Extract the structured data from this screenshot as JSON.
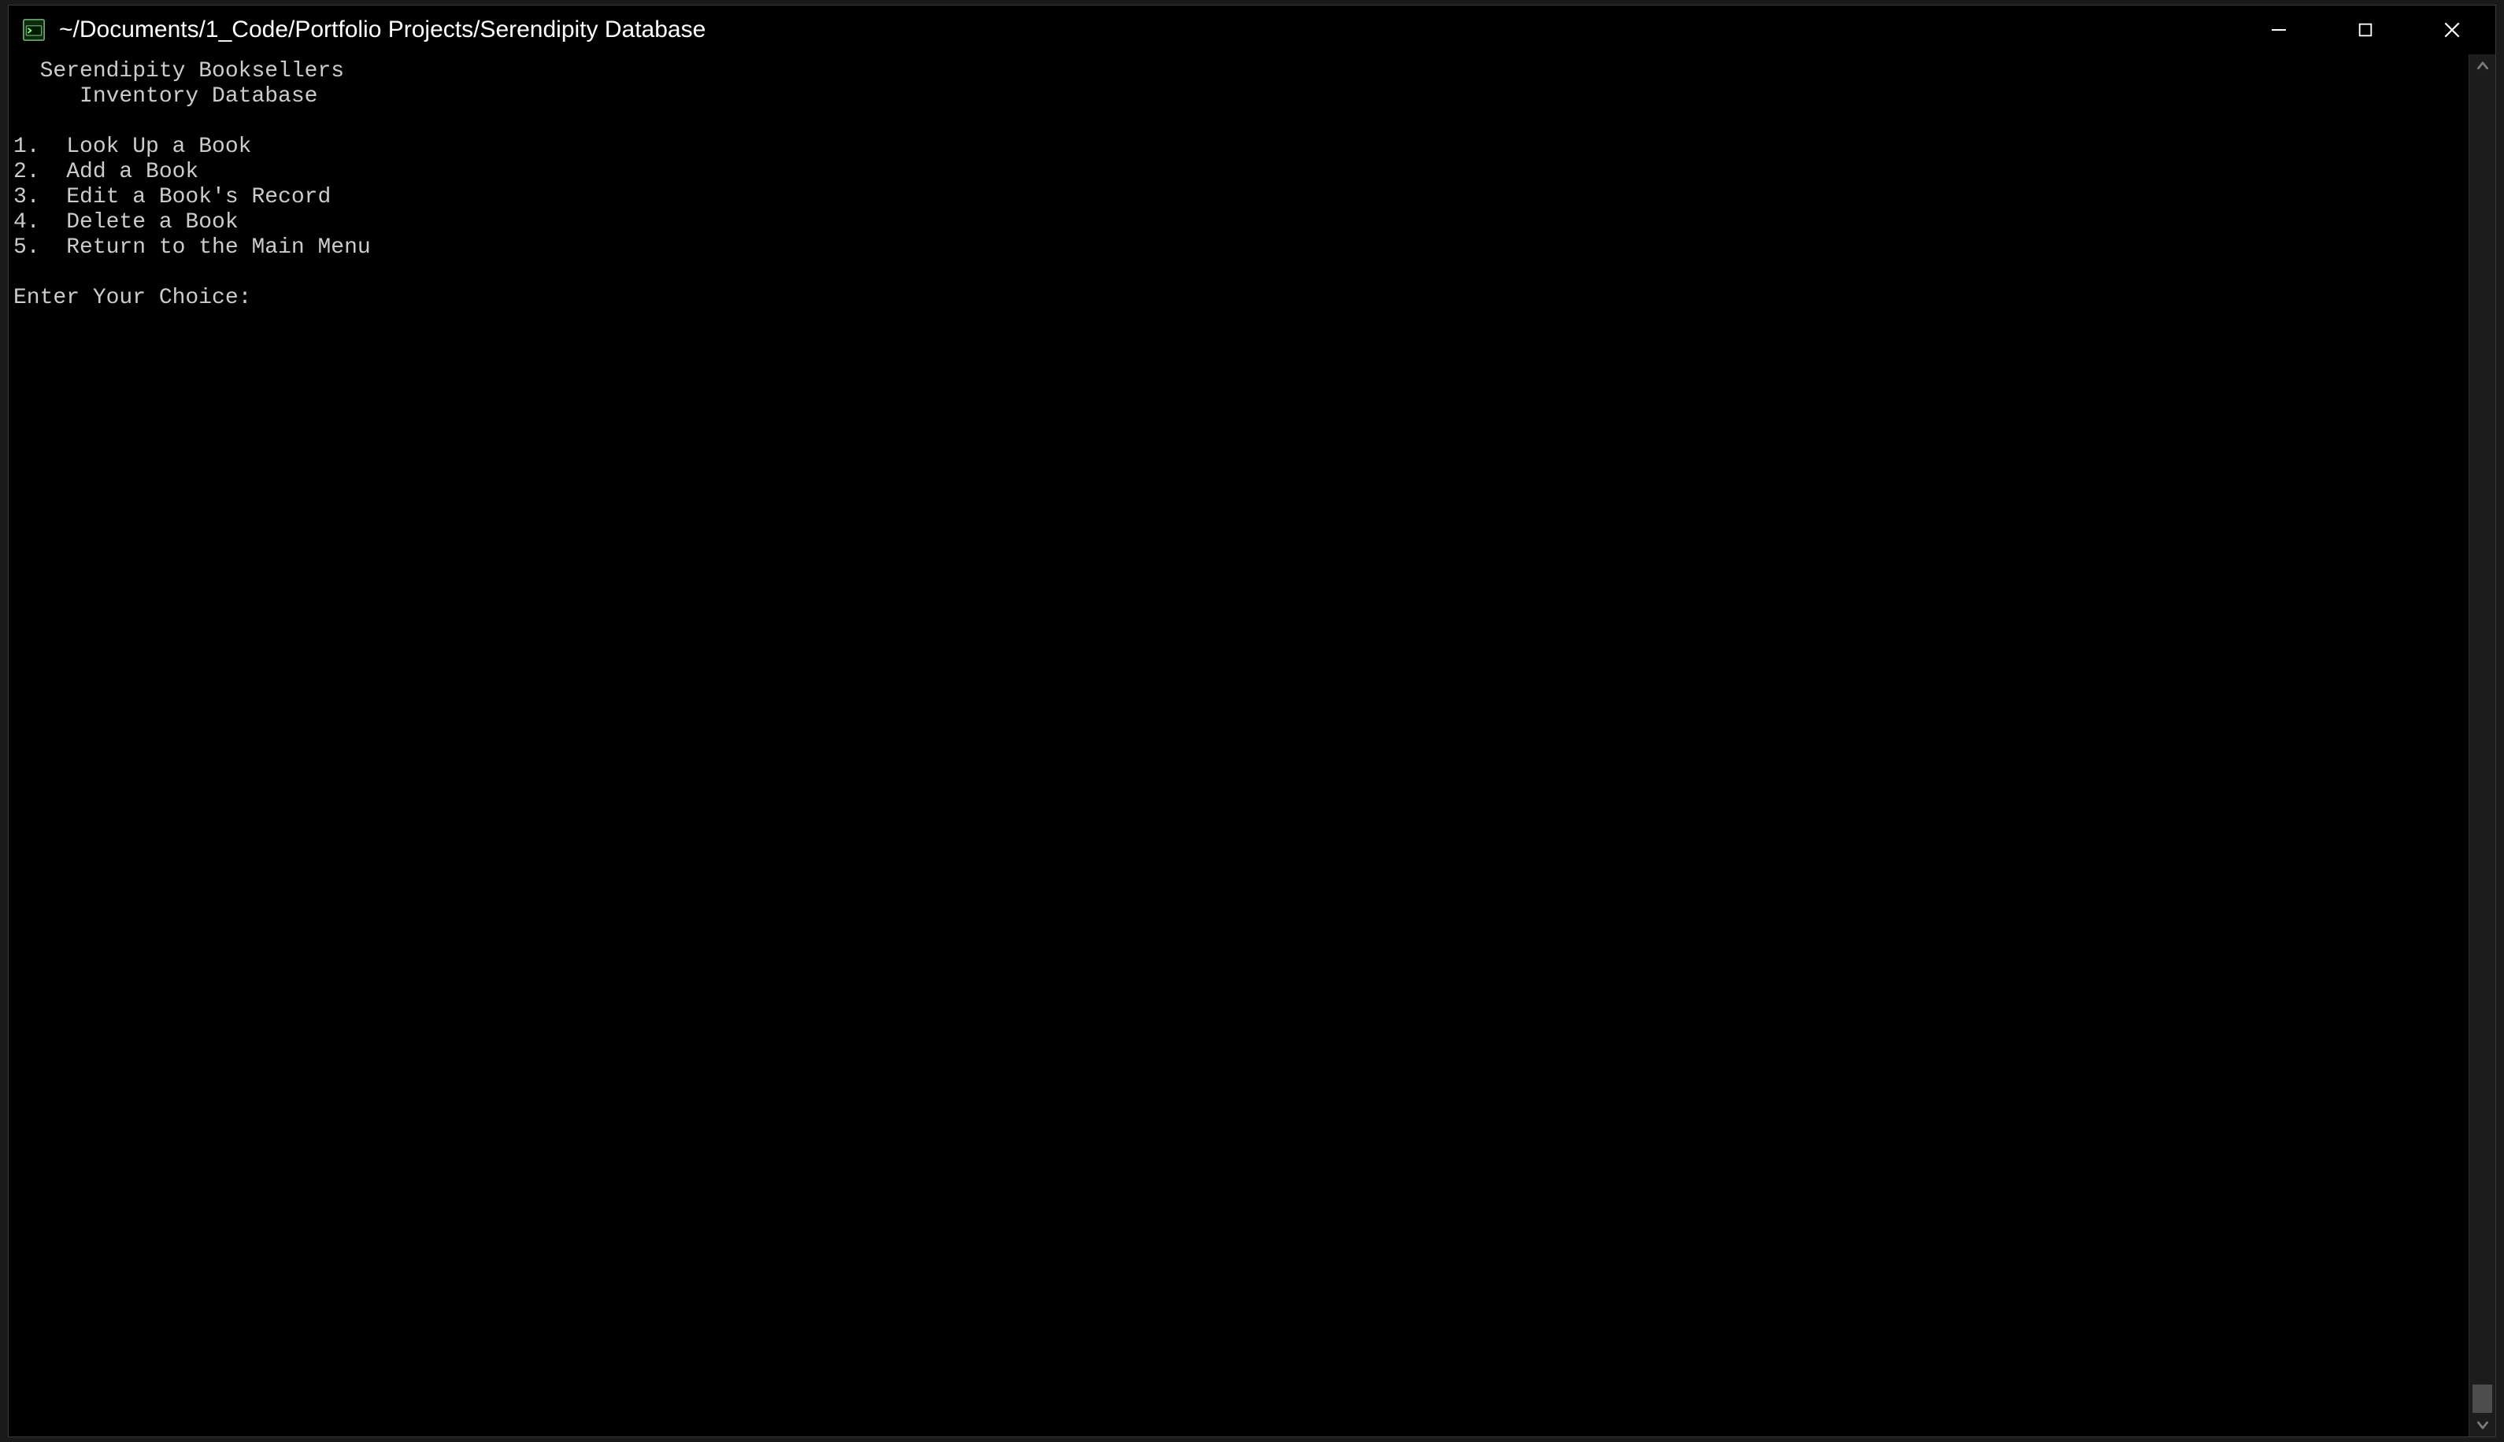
{
  "window": {
    "title": "~/Documents/1_Code/Portfolio Projects/Serendipity Database"
  },
  "terminal": {
    "heading_line1": "  Serendipity Booksellers",
    "heading_line2": "     Inventory Database",
    "menu": [
      {
        "num": "1.",
        "label": "Look Up a Book"
      },
      {
        "num": "2.",
        "label": "Add a Book"
      },
      {
        "num": "3.",
        "label": "Edit a Book's Record"
      },
      {
        "num": "4.",
        "label": "Delete a Book"
      },
      {
        "num": "5.",
        "label": "Return to the Main Menu"
      }
    ],
    "prompt": "Enter Your Choice: "
  }
}
